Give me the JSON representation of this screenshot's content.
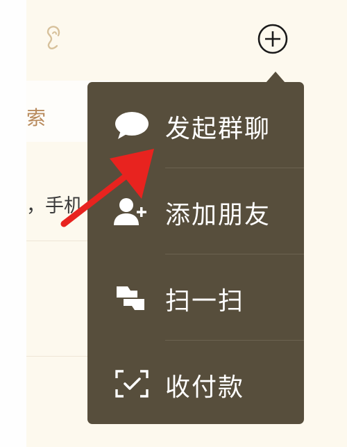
{
  "header": {
    "voice_icon": "ear-icon",
    "plus_icon": "add-circle-icon"
  },
  "search": {
    "label": "索"
  },
  "hint": {
    "text": "，手机"
  },
  "menu": {
    "items": [
      {
        "label": "发起群聊",
        "icon": "chat-bubble-icon"
      },
      {
        "label": "添加朋友",
        "icon": "add-friend-icon"
      },
      {
        "label": "扫一扫",
        "icon": "scan-icon"
      },
      {
        "label": "收付款",
        "icon": "payment-scan-icon"
      }
    ]
  },
  "annotation": {
    "arrow_color": "#e8231f"
  },
  "colors": {
    "menu_bg": "#574e3c",
    "page_bg": "#fdf9ee",
    "accent_text": "#b88a5c"
  }
}
